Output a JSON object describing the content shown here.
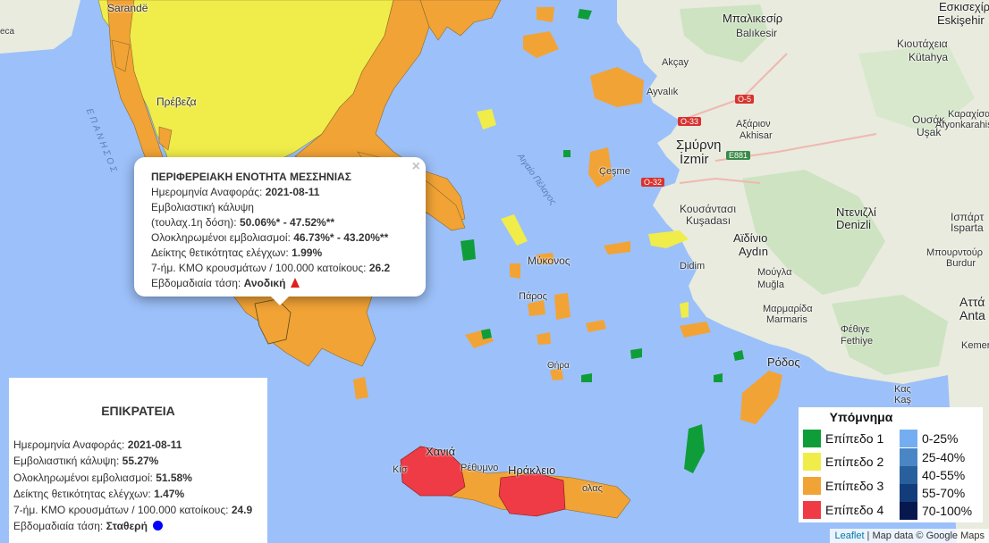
{
  "map_labels": {
    "sarande": "Sarandë",
    "seca": "eca",
    "epanisos": "ΕΠΑΝΗΣΟΣ",
    "preveza": "Πρέβεζα",
    "eskisehir_gr": "Εσκισεχίρ",
    "eskisehir": "Eskişehir",
    "balikesir_gr": "Μπαλικεσίρ",
    "balikesir": "Balıkesir",
    "kioutaheia": "Κιουτάχεια",
    "kutahya": "Kütahya",
    "akcay": "Akçay",
    "ayvalik": "Ayvalık",
    "akhisar_gr": "Αξάριον",
    "akhisar": "Akhisar",
    "usak_gr": "Ουσάκ",
    "usak": "Uşak",
    "karahisar_gr": "Καραχίσαρ",
    "afyonkarahisar": "Afyonkarahisar",
    "smyrni": "Σμύρνη",
    "izmir": "İzmir",
    "cesme": "Çeşme",
    "aigaio": "Αιγαίο Πέλαγος",
    "kousantasi": "Κουσάντασι",
    "kusadasi": "Kuşadası",
    "ntenizli": "Ντενιζλί",
    "denizli": "Denizli",
    "isparta_gr": "Ισπάρτ",
    "isparta": "Isparta",
    "aidinio": "Αϊδίνιο",
    "aydin": "Aydın",
    "mpourntour": "Μπουρντούρ",
    "burdur": "Burdur",
    "mykonos": "Μύκονος",
    "didim": "Didim",
    "mougla": "Μούγλα",
    "mugla": "Muğla",
    "paros": "Πάρος",
    "marmaris_gr": "Μαρμαρίδα",
    "marmaris": "Marmaris",
    "fethiye_gr": "Φέθιγε",
    "fethiye": "Fethiye",
    "antalya_gr": "Αττά",
    "antalya": "Anta",
    "kemer": "Kemer",
    "thira": "Θήρα",
    "rodos": "Ρόδος",
    "kas_gr": "Κας",
    "kas": "Kaş",
    "chania": "Χανιά",
    "kisamos": "Κίσ",
    "rethymno": "Ρέθυμνο",
    "irakleio": "Ηράκλειο",
    "kritis": "ολας",
    "road_o33": "O-33",
    "road_o5": "O-5",
    "road_o32": "O-32",
    "road_e881": "E881"
  },
  "popup": {
    "title": "ΠΕΡΙΦΕΡΕΙΑΚΗ ΕΝΟΤΗΤΑ ΜΕΣΣΗΝΙΑΣ",
    "close": "×",
    "date_label": "Ημερομηνία Αναφοράς: ",
    "date_value": "2021-08-11",
    "coverage_label_1": "Εμβολιαστική κάλυψη",
    "coverage_label_2": "(τουλαχ.1η δόση): ",
    "coverage_value": "50.06%* - 47.52%**",
    "full_label": "Ολοκληρωμένοι εμβολιασμοί: ",
    "full_value": "46.73%* - 43.20%**",
    "positivity_label": "Δείκτης θετικότητας ελέγχων: ",
    "positivity_value": "1.99%",
    "cases_label": "7-ήμ. ΚΜΟ κρουσμάτων / 100.000 κατοίκους: ",
    "cases_value": "26.2",
    "trend_label": "Εβδομαδιαία τάση: ",
    "trend_value": "Ανοδική"
  },
  "national": {
    "title": "ΕΠΙΚΡΑΤΕΙΑ",
    "date_label": "Ημερομηνία Αναφοράς: ",
    "date_value": "2021-08-11",
    "coverage_label": "Εμβολιαστική κάλυψη: ",
    "coverage_value": "55.27%",
    "full_label": "Ολοκληρωμένοι εμβολιασμοί: ",
    "full_value": "51.58%",
    "positivity_label": "Δείκτης θετικότητας ελέγχων: ",
    "positivity_value": "1.47%",
    "cases_label": "7-ήμ. ΚΜΟ κρουσμάτων / 100.000 κατοίκους: ",
    "cases_value": "24.9",
    "trend_label": "Εβδομαδιαία τάση: ",
    "trend_value": "Σταθερή"
  },
  "legend": {
    "title": "Υπόμνημα",
    "levels": [
      {
        "label": "Επίπεδο 1",
        "color": "#0f9d3a"
      },
      {
        "label": "Επίπεδο 2",
        "color": "#f0ec4a"
      },
      {
        "label": "Επίπεδο 3",
        "color": "#f2a335"
      },
      {
        "label": "Επίπεδο 4",
        "color": "#ef3b45"
      }
    ],
    "coverage": [
      {
        "label": "0-25%",
        "color": "#74aef0"
      },
      {
        "label": "25-40%",
        "color": "#4a86c6"
      },
      {
        "label": "40-55%",
        "color": "#28609e"
      },
      {
        "label": "55-70%",
        "color": "#123d7a"
      },
      {
        "label": "70-100%",
        "color": "#06184e"
      }
    ]
  },
  "attribution": {
    "leaflet": "Leaflet",
    "sep": " | ",
    "data": "Map data © Google Maps"
  },
  "colors": {
    "sea": "#9cc0f9",
    "land": "#e9ecdf",
    "forest": "#cfe5c4",
    "level1": "#0f9d3a",
    "level2": "#f0ec4a",
    "level3": "#f2a335",
    "level4": "#ef3b45",
    "trend_up": "#e0201c",
    "trend_stable": "#0000ff"
  }
}
